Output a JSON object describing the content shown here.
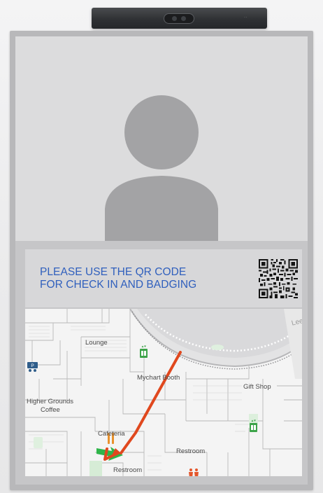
{
  "camera": {
    "icon": "camera-icon",
    "brand_color": "#2f3134"
  },
  "profile": {
    "icon": "user-avatar-placeholder-icon",
    "background_color": "#dcdcdd",
    "silhouette_color": "#a3a3a5"
  },
  "checkin": {
    "message_line1": "PLEASE USE THE QR CODE",
    "message_line2": "FOR CHECK IN AND BADGING",
    "text_color": "#2f5fbd",
    "qr_icon": "qr-code-icon"
  },
  "map": {
    "labels": {
      "lounge": "Lounge",
      "mychart_booth": "Mychart Booth",
      "gift_shop": "Gift Shop",
      "higher_grounds_line1": "Higher Grounds",
      "higher_grounds_line2": "Coffee",
      "cafeteria": "Cafeteria",
      "restroom_right": "Restroom",
      "restroom_bottom": "Restroom",
      "street_fragment": "Lee S"
    },
    "icons": {
      "elevator": "elevator-icon",
      "elevator_right": "elevator-icon",
      "parking": "parking-icon",
      "cafeteria": "cafeteria-utensils-icon",
      "restroom_orange": "restroom-icon",
      "restroom_blue": "restroom-icon",
      "you_are_here": "green-arrow-icon",
      "route": "route-arrow-icon"
    },
    "route_color": "#e0481e",
    "marker_color": "#2fb54a"
  }
}
